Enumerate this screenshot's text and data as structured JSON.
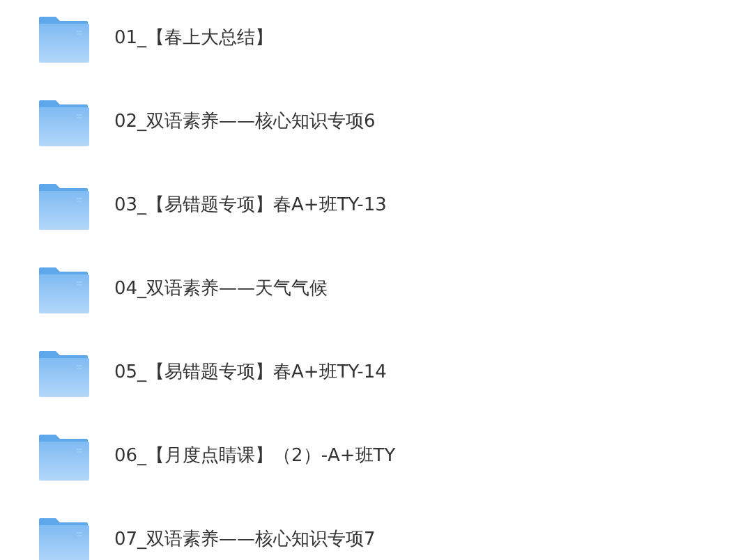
{
  "folders": [
    {
      "name": "01_【春上大总结】"
    },
    {
      "name": "02_双语素养——核心知识专项6"
    },
    {
      "name": "03_【易错题专项】春A+班TY-13"
    },
    {
      "name": "04_双语素养——天气气候"
    },
    {
      "name": "05_【易错题专项】春A+班TY-14"
    },
    {
      "name": "06_【月度点睛课】（2）-A+班TY"
    },
    {
      "name": "07_双语素养——核心知识专项7"
    }
  ]
}
